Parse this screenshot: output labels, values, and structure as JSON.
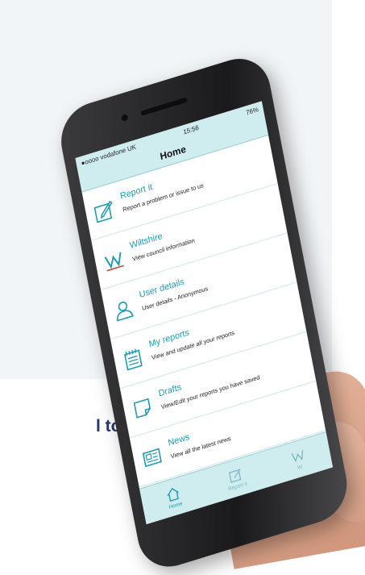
{
  "caption": {
    "text": "l to book"
  },
  "status": {
    "carrier": "●oooo vodafone UK",
    "time": "15:56",
    "battery": "76%"
  },
  "nav": {
    "title": "Home"
  },
  "menu": [
    {
      "title": "Report it",
      "subtitle": "Report a problem or issue to us",
      "icon": "pencil-square-icon"
    },
    {
      "title": "Wiltshire",
      "subtitle": "View council information",
      "icon": "w-logo-icon"
    },
    {
      "title": "User details",
      "subtitle": "User details - Anonymous",
      "icon": "user-icon"
    },
    {
      "title": "My reports",
      "subtitle": "View and update all your reports",
      "icon": "notepad-icon"
    },
    {
      "title": "Drafts",
      "subtitle": "View/Edit your reports you have saved",
      "icon": "draft-note-icon"
    },
    {
      "title": "News",
      "subtitle": "View all the latest news",
      "icon": "newspaper-icon"
    }
  ],
  "tabs": [
    {
      "label": "Home",
      "icon": "home-icon"
    },
    {
      "label": "Report it",
      "icon": "pencil-square-icon"
    },
    {
      "label": "W",
      "icon": "w-logo-icon"
    }
  ],
  "colors": {
    "accent": "#1f9bb2",
    "bar": "#cfecef",
    "caption": "#24366b"
  }
}
